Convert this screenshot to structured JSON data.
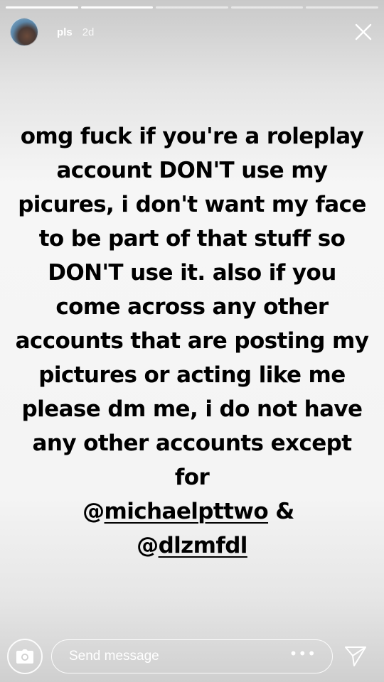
{
  "progress": {
    "segments": 5,
    "completed": 2
  },
  "header": {
    "avatar_icon": "profile-avatar",
    "username": "pls",
    "time": "2d",
    "close_icon": "close-icon"
  },
  "story": {
    "text_before": "omg fuck if you're a roleplay account DON'T use my picures, i don't want my face to be part of that stuff so DON'T use it. also if you come across any other accounts that are posting my pictures or acting like me please dm me, i do not have any other accounts except for",
    "mention_1_prefix": "@",
    "mention_1": "michaelpttwo",
    "between": " & ",
    "mention_2_prefix": "@",
    "mention_2": "dlzmfdl"
  },
  "footer": {
    "camera_icon": "camera-icon",
    "message_placeholder": "Send message",
    "more_label": "•••",
    "send_icon": "send-icon"
  }
}
